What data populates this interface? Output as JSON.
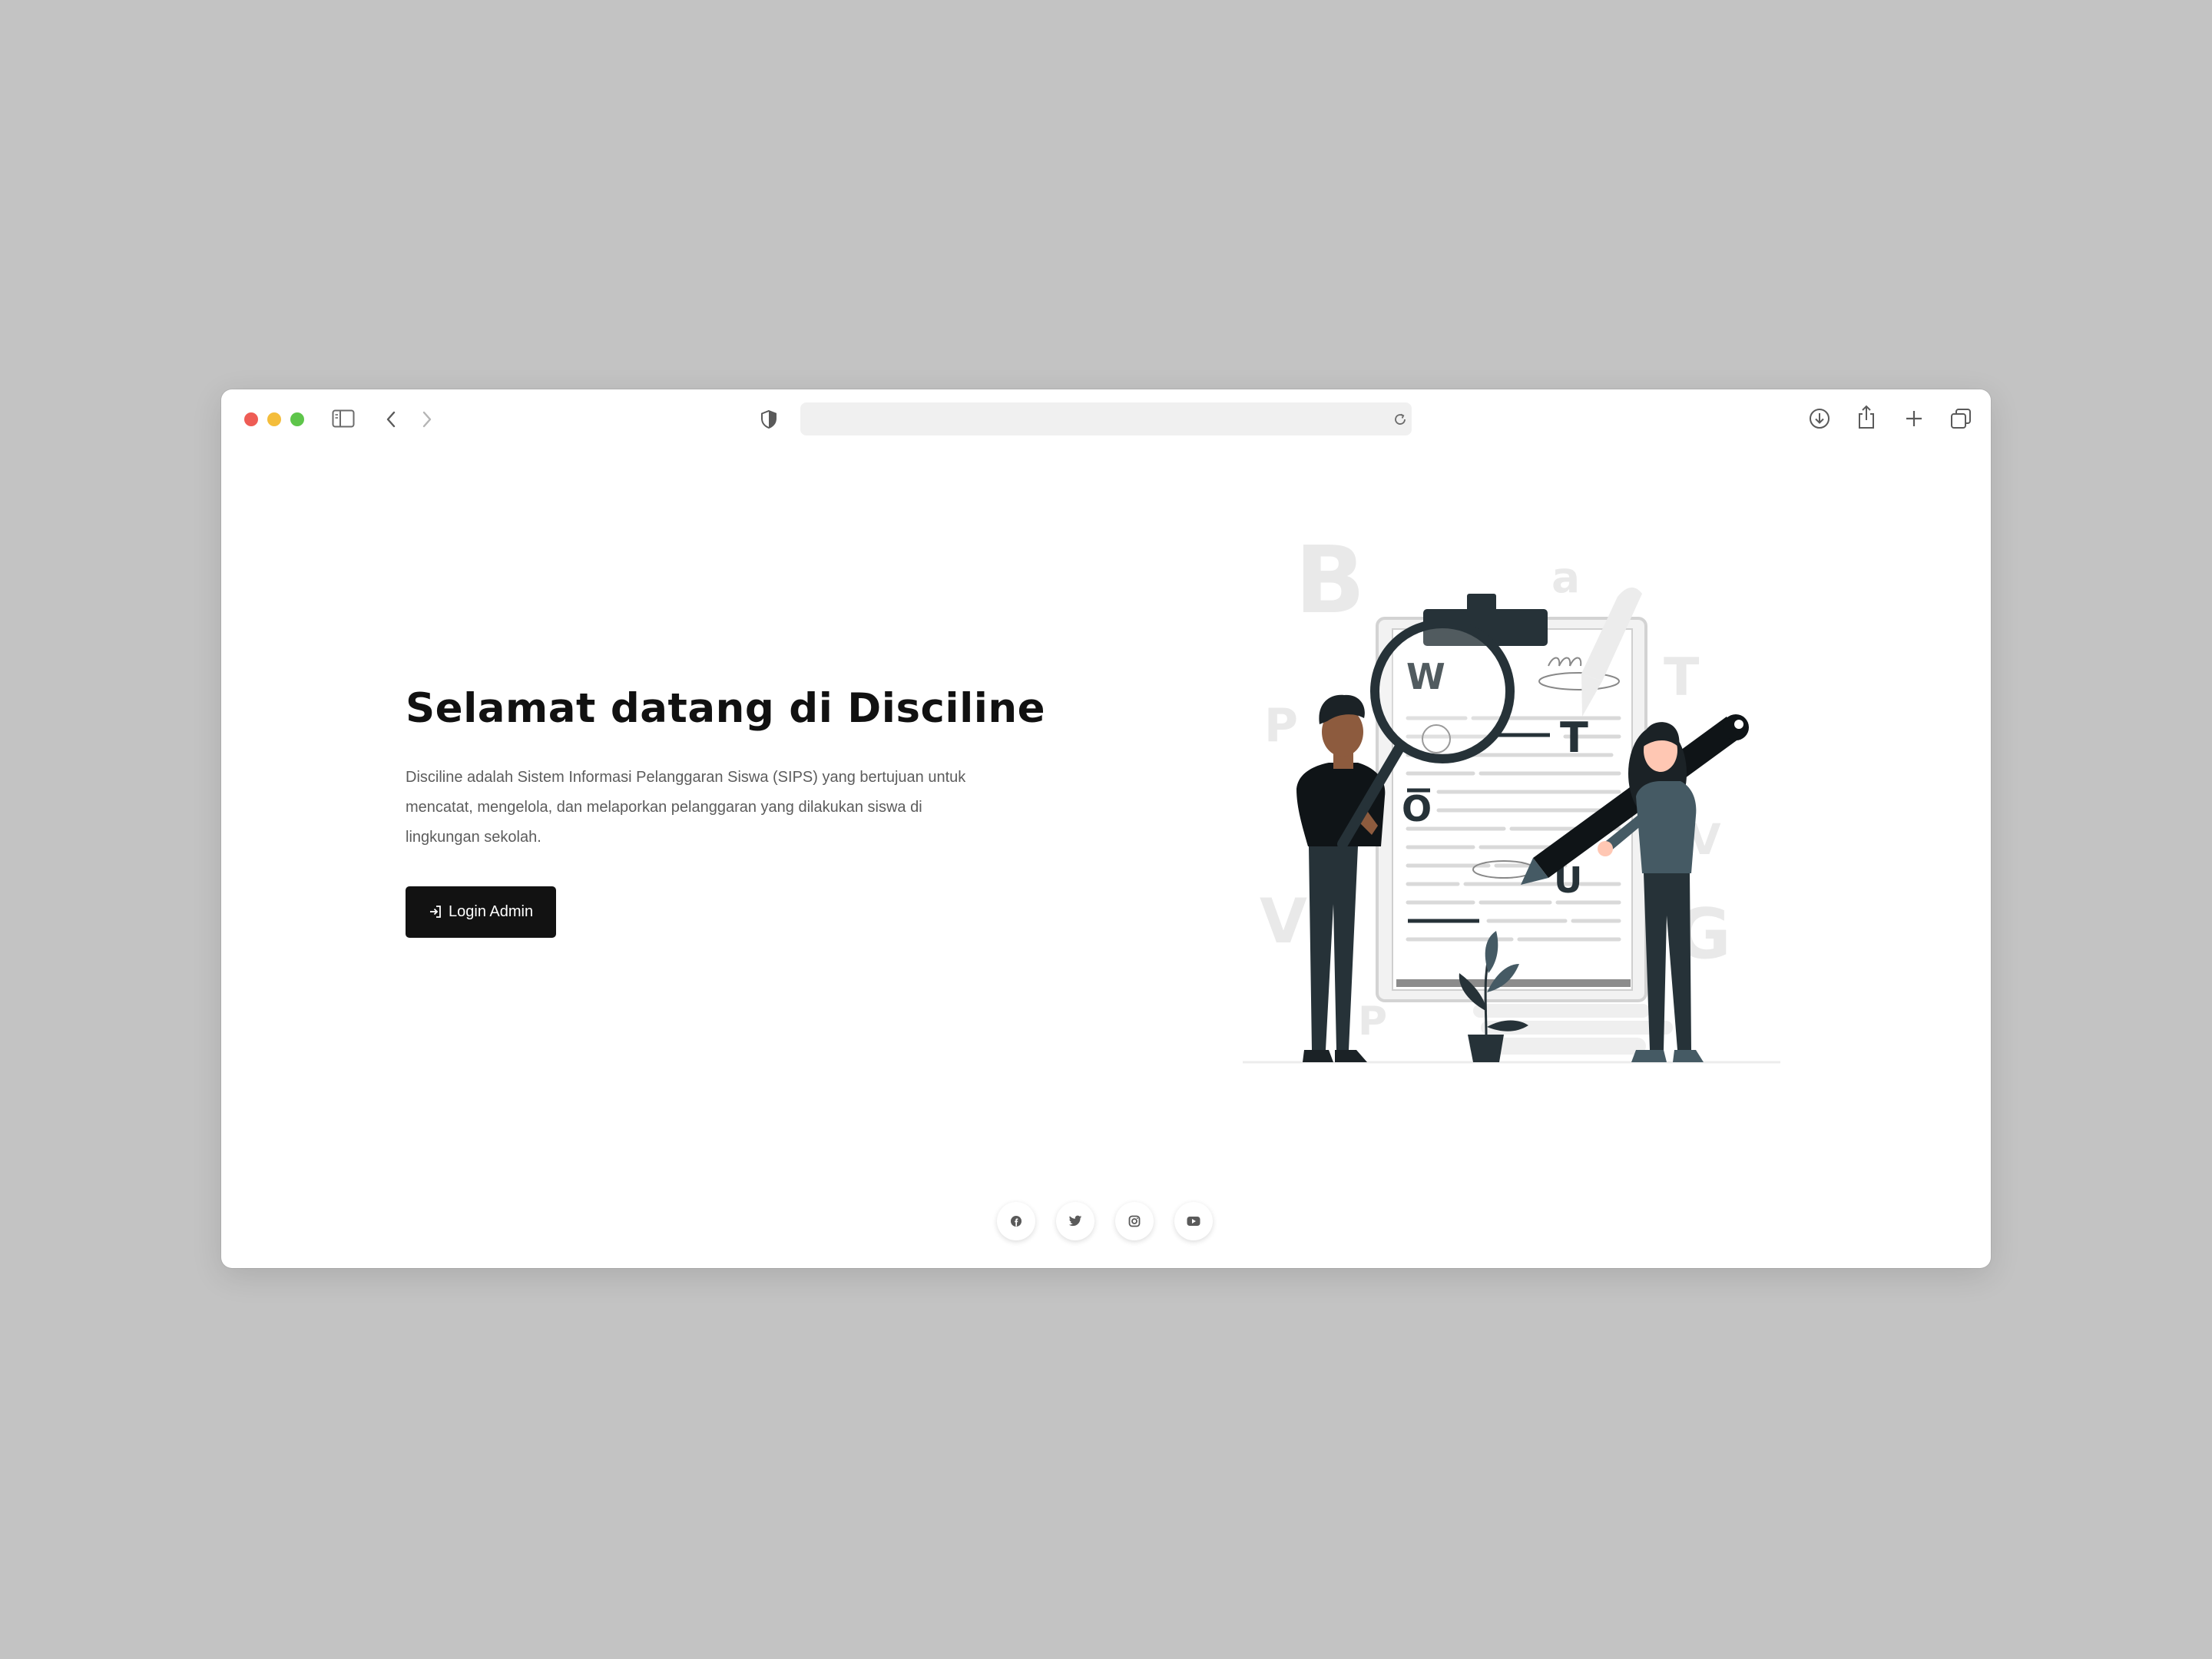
{
  "browser": {
    "address_bar": "",
    "icons": [
      "sidebar-icon",
      "back-arrow-icon",
      "forward-arrow-icon",
      "privacy-shield-icon",
      "reload-icon",
      "download-icon",
      "share-icon",
      "new-tab-icon",
      "tabs-overview-icon"
    ]
  },
  "hero": {
    "title": "Selamat datang di Disciline",
    "description": "Disciline adalah Sistem Informasi Pelanggaran Siswa (SIPS) yang bertujuan untuk mencatat, mengelola, dan melaporkan pelanggaran yang dilakukan siswa di lingkungan sekolah.",
    "button_label": "Login Admin",
    "button_icon": "login-icon"
  },
  "illustration": {
    "background_letters": [
      "B",
      "a",
      "T",
      "P",
      "V",
      "V",
      "G",
      "P"
    ],
    "clipboard_letters": [
      "W",
      "T",
      "O",
      "U"
    ]
  },
  "footer": {
    "social_icons": [
      "facebook-icon",
      "twitter-icon",
      "instagram-icon",
      "youtube-icon"
    ]
  },
  "colors": {
    "page_background": "#c3c3c3",
    "button_background": "#121212",
    "illustration_dark": "#263238",
    "traffic_red": "#ee5c55",
    "traffic_yellow": "#f4bd3b",
    "traffic_green": "#5ec54a"
  }
}
